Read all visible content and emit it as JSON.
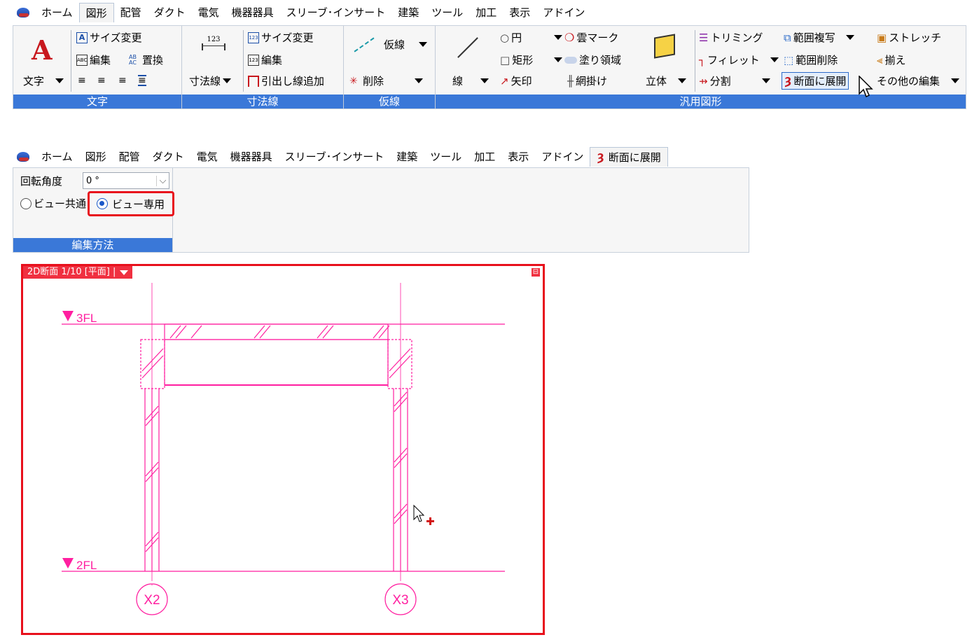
{
  "ribbon1": {
    "tabs": [
      "ホーム",
      "図形",
      "配管",
      "ダクト",
      "電気",
      "機器器具",
      "スリーブ･インサート",
      "建築",
      "ツール",
      "加工",
      "表示",
      "アドイン"
    ],
    "active_tab": "図形",
    "groups": {
      "text": {
        "footer": "文字",
        "big_label": "文字",
        "size_change": "サイズ変更",
        "edit": "編集",
        "replace": "置換"
      },
      "dimension": {
        "footer": "寸法線",
        "big_label": "寸法線",
        "big_icon_text": "123",
        "size_change": "サイズ変更",
        "edit": "編集",
        "leader_add": "引出し線追加"
      },
      "temp": {
        "footer": "仮線",
        "line": "仮線",
        "delete": "削除"
      },
      "general": {
        "footer": "汎用図形",
        "line": "線",
        "circle": "円",
        "rect": "矩形",
        "arrow": "矢印",
        "cloud": "雲マーク",
        "fill": "塗り領域",
        "hatch": "網掛け",
        "solid": "立体",
        "trim": "トリミング",
        "fillet": "フィレット",
        "split": "分割",
        "range_copy": "範囲複写",
        "range_delete": "範囲削除",
        "section_expand": "断面に展開",
        "stretch": "ストレッチ",
        "align": "揃え",
        "other_edit": "その他の編集"
      }
    }
  },
  "ribbon2": {
    "tabs": [
      "ホーム",
      "図形",
      "配管",
      "ダクト",
      "電気",
      "機器器具",
      "スリーブ･インサート",
      "建築",
      "ツール",
      "加工",
      "表示",
      "アドイン"
    ],
    "context_tab": "断面に展開",
    "rotation_label": "回転角度",
    "rotation_value": "0 °",
    "radio_common": "ビュー共通",
    "radio_view_only": "ビュー専用",
    "selected_radio": "ビュー専用",
    "group_footer": "編集方法"
  },
  "view": {
    "title": "2D断面 1/10 [平面] |",
    "levels": [
      "3FL",
      "2FL"
    ],
    "grid_labels": [
      "X2",
      "X3"
    ]
  },
  "colors": {
    "accent": "#3a78d8",
    "drawing": "#ff1fa0",
    "highlight": "#e8101c"
  }
}
